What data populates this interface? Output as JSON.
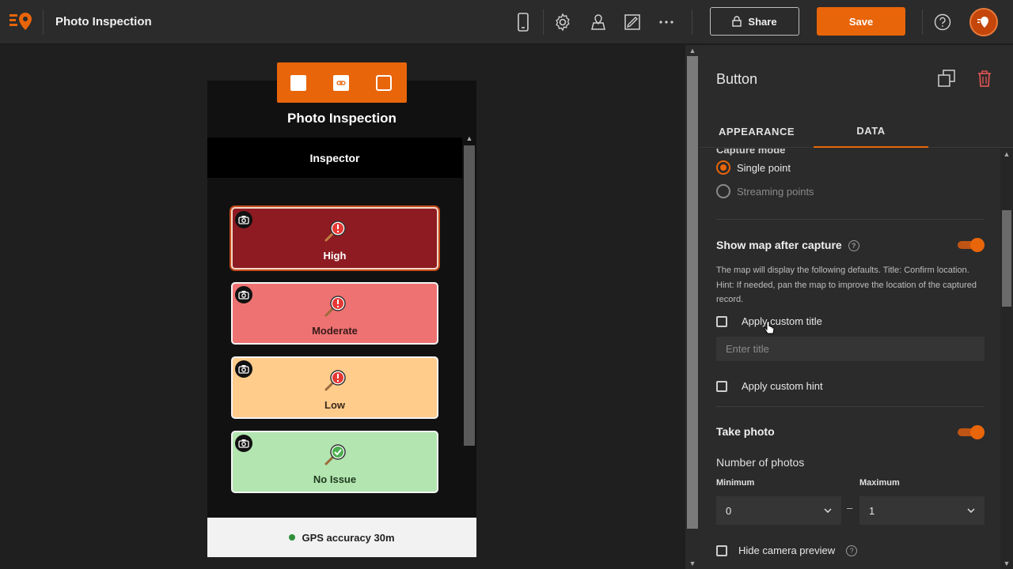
{
  "app": {
    "title": "Photo Inspection",
    "share_label": "Share",
    "save_label": "Save"
  },
  "colors": {
    "accent": "#e8650a",
    "high": "#8e1b22",
    "moderate": "#ee7272",
    "low": "#ffcc8c",
    "no_issue": "#b3e5b0"
  },
  "toolbar_icons": [
    "mobile-preview-icon",
    "gear-icon",
    "map-pin-icon",
    "edit-form-icon",
    "more-icon",
    "help-icon"
  ],
  "phone": {
    "title": "Photo Inspection",
    "inspector_label": "Inspector",
    "choices": [
      {
        "label": "High",
        "selected": true
      },
      {
        "label": "Moderate",
        "selected": false
      },
      {
        "label": "Low",
        "selected": false
      },
      {
        "label": "No Issue",
        "selected": false
      }
    ],
    "gps_text": "GPS accuracy 30m"
  },
  "panel": {
    "title": "Button",
    "tabs": [
      {
        "label": "APPEARANCE",
        "active": false
      },
      {
        "label": "DATA",
        "active": true
      }
    ],
    "capture_mode_label": "Capture mode",
    "capture_options": [
      {
        "label": "Single point",
        "selected": true
      },
      {
        "label": "Streaming points",
        "selected": false
      }
    ],
    "show_map": {
      "label": "Show map after capture",
      "enabled": true,
      "description": "The map will display the following defaults. Title: Confirm location. Hint: If needed, pan the map to improve the location of the captured record."
    },
    "custom_title": {
      "label": "Apply custom title",
      "checked": false,
      "placeholder": "Enter title"
    },
    "custom_hint": {
      "label": "Apply custom hint",
      "checked": false
    },
    "take_photo": {
      "label": "Take photo",
      "enabled": true
    },
    "number_of_photos": {
      "label": "Number of photos",
      "minimum_label": "Minimum",
      "minimum_value": "0",
      "maximum_label": "Maximum",
      "maximum_value": "1",
      "separator": "–"
    },
    "hide_camera_preview": {
      "label": "Hide camera preview",
      "checked": false
    }
  }
}
